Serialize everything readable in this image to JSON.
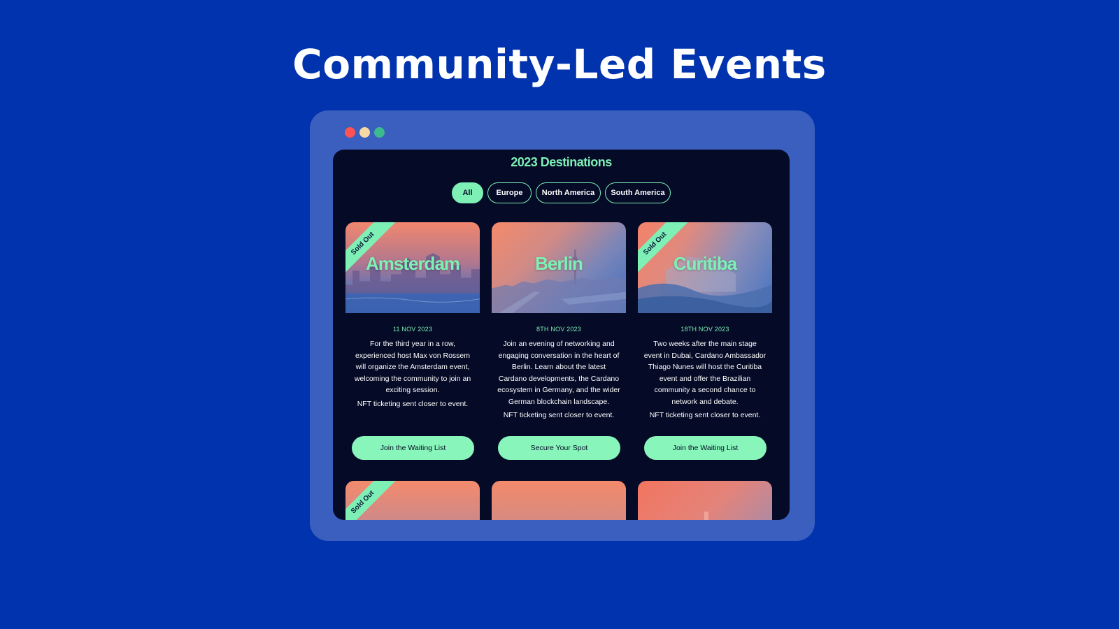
{
  "headline": "Community-Led Events",
  "window": {
    "dots": [
      {
        "name": "close-dot",
        "color": "#ff5252"
      },
      {
        "name": "minimize-dot",
        "color": "#f7d9a3"
      },
      {
        "name": "maximize-dot",
        "color": "#3dbb8e"
      }
    ]
  },
  "screen": {
    "title": "2023 Destinations",
    "filters": [
      "All",
      "Europe",
      "North America",
      "South America"
    ],
    "active_filter": "All"
  },
  "colors": {
    "page_bg": "#0033ad",
    "window_bg": "#3a5fbe",
    "screen_bg": "#050a26",
    "accent": "#7ef0b6"
  },
  "events": [
    {
      "city": "Amsterdam",
      "sold_out": "Sold Out",
      "date": "11 NOV 2023",
      "description": "For the third year in a row, experienced host Max von Rossem will organize the Amsterdam event, welcoming the community to join an exciting session.",
      "ticketing": "NFT ticketing sent closer to event.",
      "cta": "Join the Waiting List"
    },
    {
      "city": "Berlin",
      "date": "8TH NOV 2023",
      "description": "Join an evening of networking and engaging conversation in the heart of Berlin. Learn about the latest Cardano developments, the Cardano ecosystem in Germany, and the wider German blockchain landscape.",
      "ticketing": "NFT ticketing sent closer to event.",
      "cta": "Secure Your Spot"
    },
    {
      "city": "Curitiba",
      "sold_out": "Sold Out",
      "date": "18TH NOV 2023",
      "description": "Two weeks after the main stage event in Dubai, Cardano Ambassador Thiago Nunes will host the Curitiba event and offer the Brazilian community a second chance to network and debate.",
      "ticketing": "NFT ticketing sent closer to event.",
      "cta": "Join the Waiting List"
    },
    {
      "sold_out": "Sold Out"
    }
  ]
}
